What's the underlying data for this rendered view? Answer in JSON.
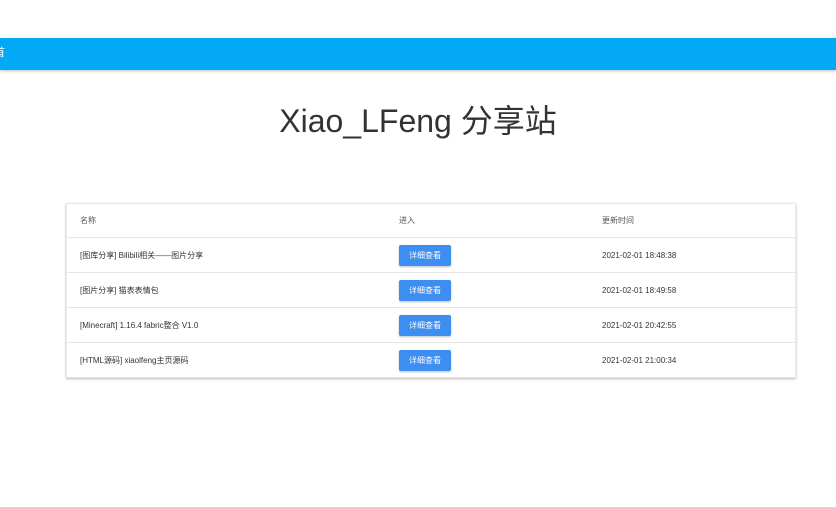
{
  "header": {
    "label": "首"
  },
  "title": "Xiao_LFeng 分享站",
  "table": {
    "columns": [
      "名称",
      "进入",
      "更新时间"
    ],
    "rows": [
      {
        "name": "[图库分享] Bilibili相关——图片分享",
        "button": "详细查看",
        "updated": "2021-02-01 18:48:38"
      },
      {
        "name": "[图片分享] 猫表表情包",
        "button": "详细查看",
        "updated": "2021-02-01 18:49:58"
      },
      {
        "name": "[Minecraft] 1.16.4 fabric整合 V1.0",
        "button": "详细查看",
        "updated": "2021-02-01 20:42:55"
      },
      {
        "name": "[HTML源码] xiaolfeng主页源码",
        "button": "详细查看",
        "updated": "2021-02-01 21:00:34"
      }
    ]
  },
  "colors": {
    "header_bar": "#03a9f4",
    "button": "#3d8ef0"
  }
}
